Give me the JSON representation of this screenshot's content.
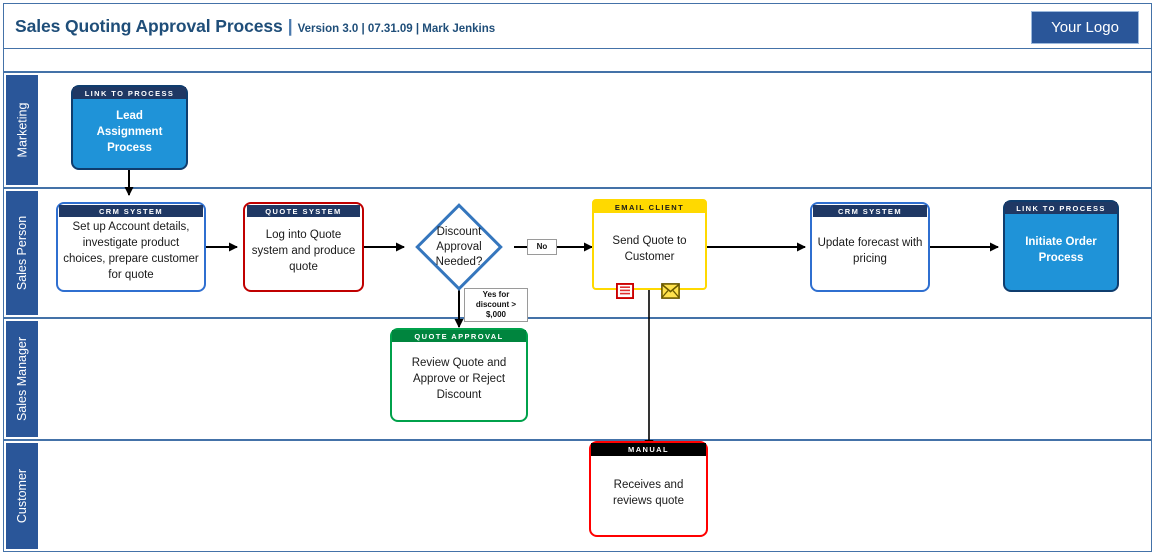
{
  "header": {
    "title_main": "Sales Quoting Approval Process",
    "separator": "|",
    "subtitle": "Version 3.0 | 07.31.09 | Mark Jenkins",
    "logo_label": "Your Logo"
  },
  "lanes": [
    {
      "id": "marketing",
      "label": "Marketing"
    },
    {
      "id": "sales-person",
      "label": "Sales Person"
    },
    {
      "id": "sales-manager",
      "label": "Sales Manager"
    },
    {
      "id": "customer",
      "label": "Customer"
    }
  ],
  "nodes": {
    "lead_assignment": {
      "header": "LINK TO PROCESS",
      "text": "Lead\nAssignment Process",
      "lane": "Marketing",
      "style": "link-to-process",
      "color": "#1f93d8"
    },
    "setup_account": {
      "header": "CRM SYSTEM",
      "text": "Set up Account details, investigate product choices, prepare customer for quote",
      "lane": "Sales Person",
      "style": "system",
      "color": "#2f6fd0"
    },
    "log_into_quote": {
      "header": "QUOTE SYSTEM",
      "text": "Log into Quote system and produce quote",
      "lane": "Sales Person",
      "style": "system",
      "color": "#c00000"
    },
    "discount_decision": {
      "text": "Discount Approval Needed?",
      "lane": "Sales Person",
      "style": "decision",
      "color": "#3576bd"
    },
    "send_quote": {
      "header": "EMAIL CLIENT",
      "text": "Send Quote to Customer",
      "lane": "Sales Person",
      "style": "system",
      "color": "#ffd900"
    },
    "update_forecast": {
      "header": "CRM SYSTEM",
      "text": "Update forecast with pricing",
      "lane": "Sales Person",
      "style": "system",
      "color": "#2f6fd0"
    },
    "initiate_order": {
      "header": "LINK TO PROCESS",
      "text": "Initiate Order\nProcess",
      "lane": "Sales Person",
      "style": "link-to-process",
      "color": "#1f93d8"
    },
    "review_quote": {
      "header": "QUOTE APPROVAL",
      "text": "Review Quote and Approve or Reject Discount",
      "lane": "Sales Manager",
      "style": "system",
      "color": "#00a14b"
    },
    "receives_quote": {
      "header": "MANUAL",
      "text": "Receives and reviews quote",
      "lane": "Customer",
      "style": "manual",
      "color": "#ff0000"
    }
  },
  "edge_labels": {
    "no": "No",
    "yes_discount": "Yes for discount > $,000"
  },
  "icons": {
    "document": "document-icon",
    "envelope": "envelope-icon"
  },
  "colors": {
    "frame_border": "#4472a8",
    "lane_label_bg": "#2a5699",
    "title_text": "#1f4e79",
    "logo_bg": "#2a5699"
  }
}
